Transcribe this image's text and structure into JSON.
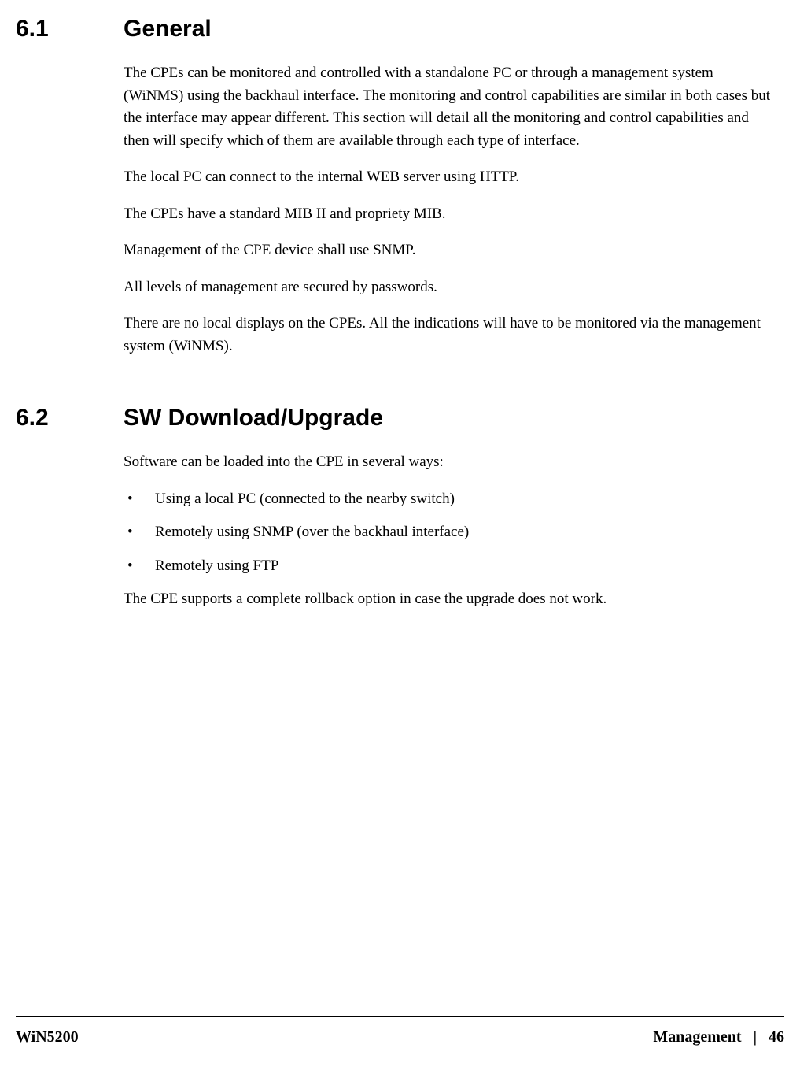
{
  "section1": {
    "number": "6.1",
    "title": "General",
    "paragraphs": [
      "The CPEs can be monitored and controlled with a standalone PC or through a management system (WiNMS) using the backhaul interface. The monitoring and control capabilities are similar in both cases but the interface may appear different. This section will detail all the monitoring and control capabilities and then will specify which of them are available through each type of interface.",
      "The local PC can connect to the internal WEB server using HTTP.",
      "The CPEs have a standard MIB II and propriety MIB.",
      "Management of the CPE device shall use SNMP.",
      "All levels of management are secured by passwords.",
      "There are no local displays on the CPEs. All the indications will have to be monitored via the management system (WiNMS)."
    ]
  },
  "section2": {
    "number": "6.2",
    "title": "SW Download/Upgrade",
    "intro": "Software can be loaded into the CPE in several ways:",
    "bullets": [
      "Using a local PC (connected to the nearby switch)",
      "Remotely using SNMP (over the backhaul interface)",
      "Remotely using FTP"
    ],
    "outro": "The CPE supports a complete rollback option in case the upgrade does not work."
  },
  "footer": {
    "left": "WiN5200",
    "chapter": "Management",
    "separator": "|",
    "page": "46"
  }
}
